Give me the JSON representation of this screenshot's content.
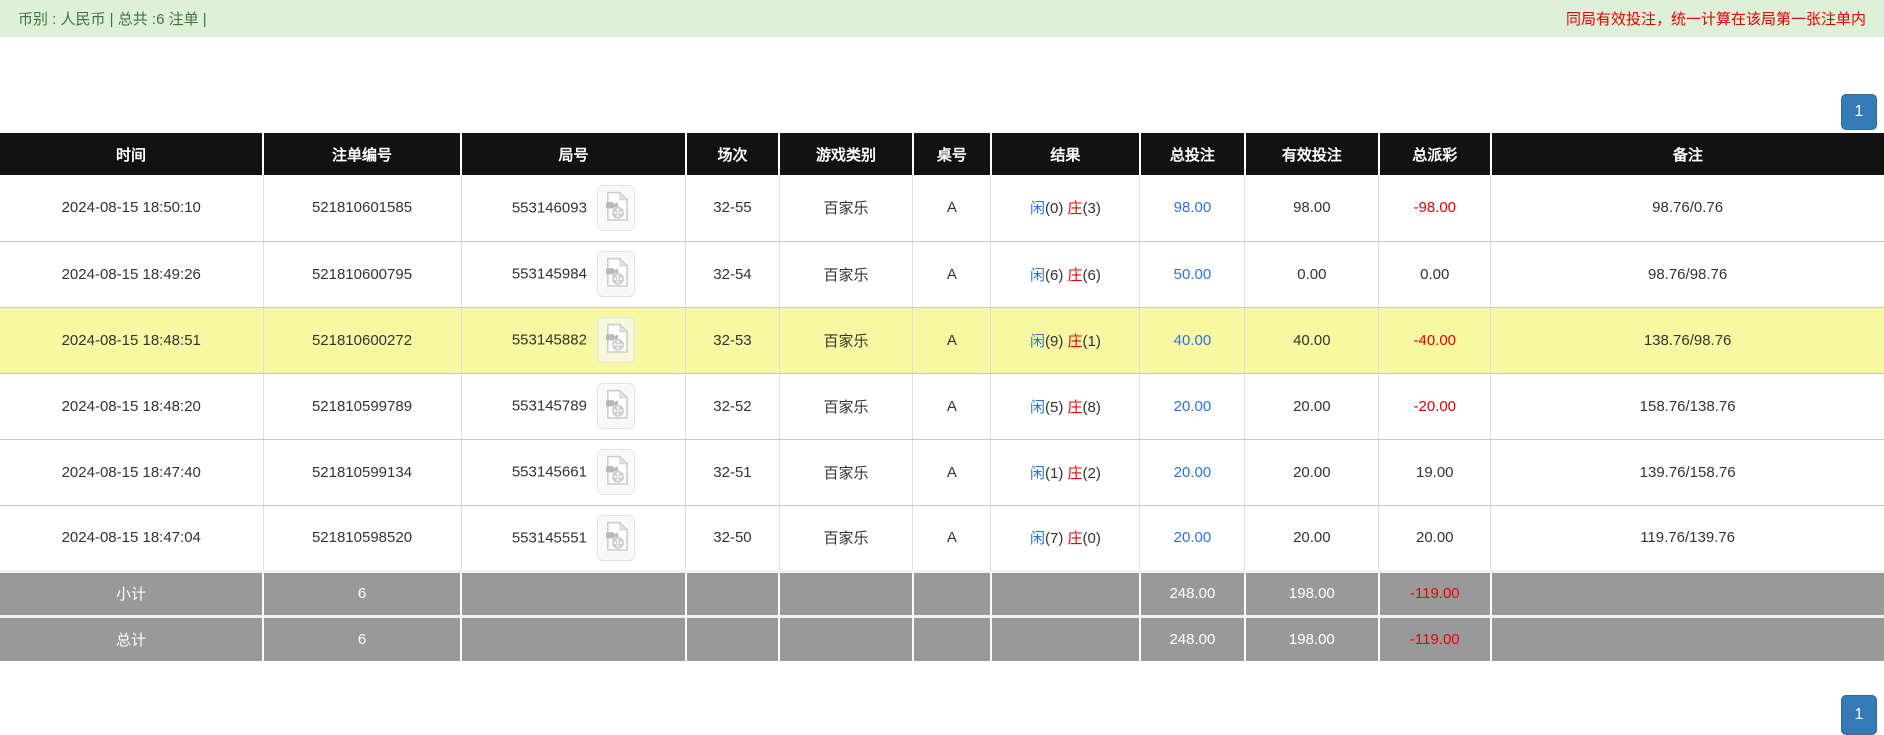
{
  "banner": {
    "left": "币别 : 人民币 | 总共 :6 注单 |",
    "right": "同局有效投注，统一计算在该局第一张注单内"
  },
  "pagination": {
    "page": "1"
  },
  "icons": {
    "video-file-icon": "document with film reel (video replay)"
  },
  "colors": {
    "banner_bg": "#dff0d8",
    "banner_green": "#3c763d",
    "alert_red": "#e60000",
    "header_bg": "#121212",
    "highlight_yellow": "#f8f8a3",
    "footer_gray": "#999999",
    "value_blue": "#2b72e0",
    "pager_blue": "#337ab7"
  },
  "table": {
    "columns": [
      {
        "key": "time",
        "label": "时间",
        "width": "13.96%"
      },
      {
        "key": "bet-id",
        "label": "注单编号",
        "width": "10.51%"
      },
      {
        "key": "round-id",
        "label": "局号",
        "width": "11.94%"
      },
      {
        "key": "session",
        "label": "场次",
        "width": "4.94%"
      },
      {
        "key": "game-type",
        "label": "游戏类别",
        "width": "7.11%"
      },
      {
        "key": "table-no",
        "label": "桌号",
        "width": "4.14%"
      },
      {
        "key": "result",
        "label": "结果",
        "width": "7.91%"
      },
      {
        "key": "total-bet",
        "label": "总投注",
        "width": "5.57%"
      },
      {
        "key": "valid-bet",
        "label": "有效投注",
        "width": "7.11%"
      },
      {
        "key": "payout",
        "label": "总派彩",
        "width": "5.94%"
      },
      {
        "key": "remark",
        "label": "备注",
        "width": "20.87%"
      }
    ],
    "rows": [
      {
        "time": "2024-08-15 18:50:10",
        "bet_id": "521810601585",
        "round_id": "553146093",
        "session": "32-55",
        "game_type": "百家乐",
        "table_no": "A",
        "result": {
          "player_label": "闲",
          "player_count": "(0)",
          "banker_label": "庄",
          "banker_count": "(3)"
        },
        "total_bet": "98.00",
        "valid_bet": "98.00",
        "payout": "-98.00",
        "remark": "98.76/0.76",
        "highlighted": false
      },
      {
        "time": "2024-08-15 18:49:26",
        "bet_id": "521810600795",
        "round_id": "553145984",
        "session": "32-54",
        "game_type": "百家乐",
        "table_no": "A",
        "result": {
          "player_label": "闲",
          "player_count": "(6)",
          "banker_label": "庄",
          "banker_count": "(6)"
        },
        "total_bet": "50.00",
        "valid_bet": "0.00",
        "payout": "0.00",
        "remark": "98.76/98.76",
        "highlighted": false
      },
      {
        "time": "2024-08-15 18:48:51",
        "bet_id": "521810600272",
        "round_id": "553145882",
        "session": "32-53",
        "game_type": "百家乐",
        "table_no": "A",
        "result": {
          "player_label": "闲",
          "player_count": "(9)",
          "banker_label": "庄",
          "banker_count": "(1)"
        },
        "total_bet": "40.00",
        "valid_bet": "40.00",
        "payout": "-40.00",
        "remark": "138.76/98.76",
        "highlighted": true
      },
      {
        "time": "2024-08-15 18:48:20",
        "bet_id": "521810599789",
        "round_id": "553145789",
        "session": "32-52",
        "game_type": "百家乐",
        "table_no": "A",
        "result": {
          "player_label": "闲",
          "player_count": "(5)",
          "banker_label": "庄",
          "banker_count": "(8)"
        },
        "total_bet": "20.00",
        "valid_bet": "20.00",
        "payout": "-20.00",
        "remark": "158.76/138.76",
        "highlighted": false
      },
      {
        "time": "2024-08-15 18:47:40",
        "bet_id": "521810599134",
        "round_id": "553145661",
        "session": "32-51",
        "game_type": "百家乐",
        "table_no": "A",
        "result": {
          "player_label": "闲",
          "player_count": "(1)",
          "banker_label": "庄",
          "banker_count": "(2)"
        },
        "total_bet": "20.00",
        "valid_bet": "20.00",
        "payout": "19.00",
        "remark": "139.76/158.76",
        "highlighted": false
      },
      {
        "time": "2024-08-15 18:47:04",
        "bet_id": "521810598520",
        "round_id": "553145551",
        "session": "32-50",
        "game_type": "百家乐",
        "table_no": "A",
        "result": {
          "player_label": "闲",
          "player_count": "(7)",
          "banker_label": "庄",
          "banker_count": "(0)"
        },
        "total_bet": "20.00",
        "valid_bet": "20.00",
        "payout": "20.00",
        "remark": "119.76/139.76",
        "highlighted": false
      }
    ],
    "subtotal": {
      "label": "小计",
      "count": "6",
      "total_bet": "248.00",
      "valid_bet": "198.00",
      "payout": "-119.00"
    },
    "total": {
      "label": "总计",
      "count": "6",
      "total_bet": "248.00",
      "valid_bet": "198.00",
      "payout": "-119.00"
    }
  }
}
